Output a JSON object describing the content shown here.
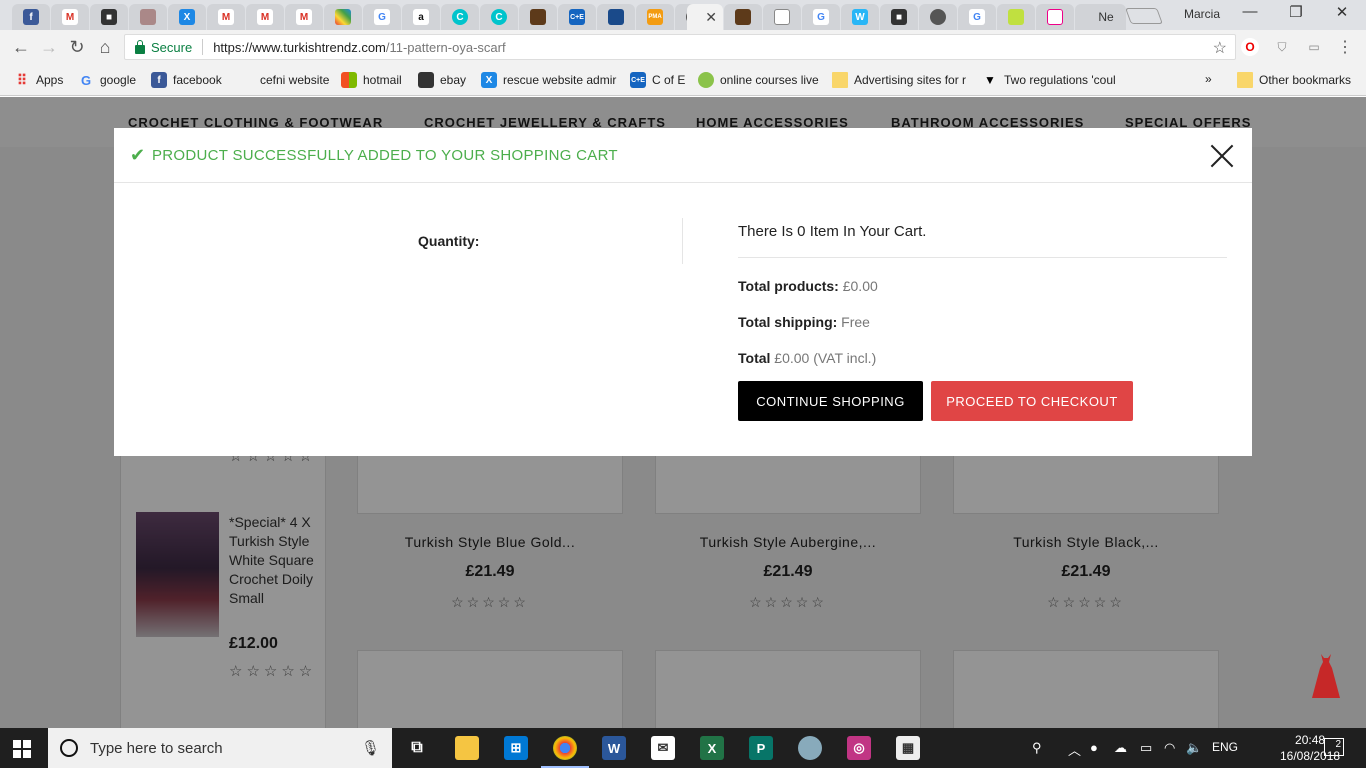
{
  "browser": {
    "url_host": "https://www.turkishtrendz.com",
    "url_path": "/11-pattern-oya-scarf",
    "secure_label": "Secure",
    "user": "Marcia",
    "last_tab_label": "Ne"
  },
  "bookmarks": [
    {
      "label": "Apps",
      "icon": "apps-grid-icon"
    },
    {
      "label": "google",
      "icon": "google-icon"
    },
    {
      "label": "facebook",
      "icon": "facebook-icon"
    },
    {
      "label": "cefni website",
      "icon": "page-icon"
    },
    {
      "label": "hotmail",
      "icon": "windows-icon"
    },
    {
      "label": "ebay",
      "icon": "bag-icon"
    },
    {
      "label": "rescue website admir",
      "icon": "x-icon"
    },
    {
      "label": "C of E",
      "icon": "cofe-icon"
    },
    {
      "label": "online courses live",
      "icon": "online-icon"
    },
    {
      "label": "Advertising sites for r",
      "icon": "folder-icon"
    },
    {
      "label": "Two regulations 'coul",
      "icon": "triangle-icon"
    }
  ],
  "bookmarks_more": "»",
  "other_bookmarks": "Other bookmarks",
  "site_menu": [
    "CROCHET CLOTHING & FOOTWEAR",
    "CROCHET JEWELLERY & CRAFTS",
    "HOME ACCESSORIES",
    "BATHROOM ACCESSORIES",
    "SPECIAL OFFERS"
  ],
  "modal": {
    "title": "PRODUCT SUCCESSFULLY ADDED TO YOUR SHOPPING CART",
    "quantity_label": "Quantity:",
    "cart_count": "There Is 0 Item In Your Cart.",
    "total_products_label": "Total products:",
    "total_products_value": "£0.00",
    "total_shipping_label": "Total shipping:",
    "total_shipping_value": "Free",
    "total_label": "Total",
    "total_value": "£0.00 (VAT incl.)",
    "continue_label": "CONTINUE SHOPPING",
    "checkout_label": "PROCEED TO CHECKOUT"
  },
  "sidebar_product": {
    "name": "*Special* 4 X Turkish Style White Square Crochet Doily Small",
    "price": "£12.00",
    "stars": "☆☆☆☆☆"
  },
  "products": [
    {
      "name": "Turkish Style Blue Gold...",
      "price": "£21.49",
      "stars": "☆☆☆☆☆"
    },
    {
      "name": "Turkish Style Aubergine,...",
      "price": "£21.49",
      "stars": "☆☆☆☆☆"
    },
    {
      "name": "Turkish Style Black,...",
      "price": "£21.49",
      "stars": "☆☆☆☆☆"
    }
  ],
  "taskbar": {
    "search_placeholder": "Type here to search",
    "lang": "ENG",
    "time": "20:48",
    "date": "16/08/2018",
    "notif_count": "2"
  }
}
